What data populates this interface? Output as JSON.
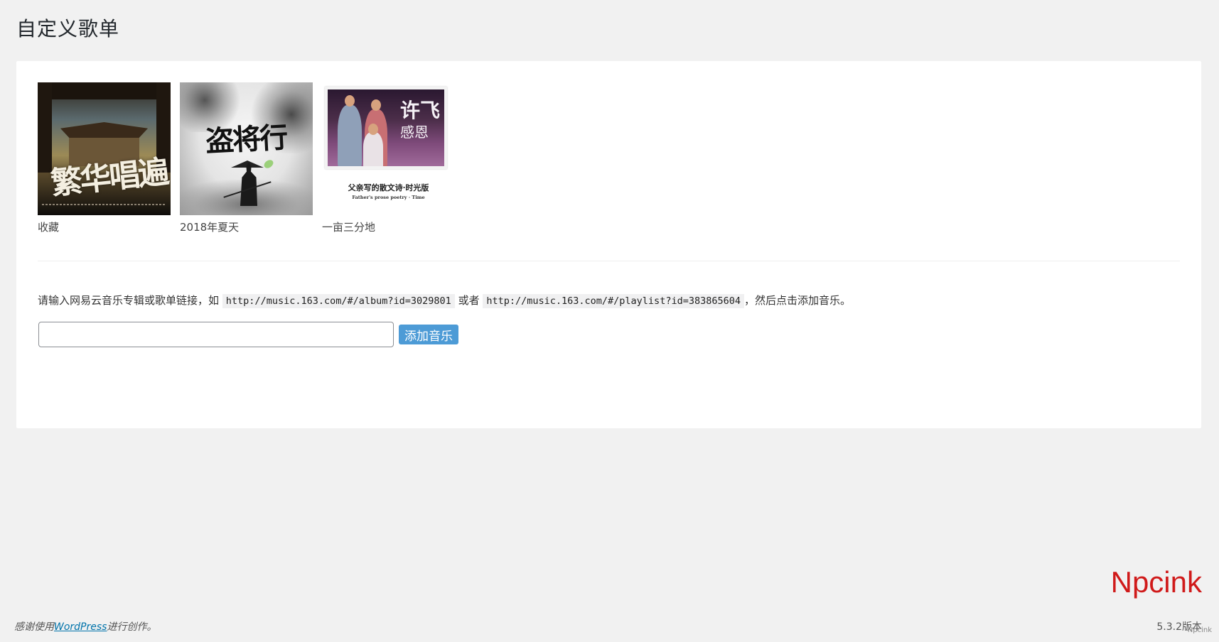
{
  "page": {
    "title": "自定义歌单"
  },
  "albums": [
    {
      "name": "收藏",
      "cover_text": "繁华唱遍"
    },
    {
      "name": "2018年夏天",
      "cover_text": "盗将行"
    },
    {
      "name": "一亩三分地",
      "cover_text": "许飞",
      "cover_subtext": "感恩",
      "cover_caption": "父亲写的散文诗·时光版",
      "cover_caption_en": "Father's prose poetry · Time"
    }
  ],
  "instructions": {
    "prefix": "请输入网易云音乐专辑或歌单链接，如",
    "example_album": "http://music.163.com/#/album?id=3029801",
    "middle": "或者",
    "example_playlist": "http://music.163.com/#/playlist?id=383865604",
    "suffix": "，然后点击添加音乐。"
  },
  "form": {
    "input_value": "",
    "add_label": "添加音乐"
  },
  "watermark": "Npcink",
  "footer": {
    "thanks_prefix": "感谢使用",
    "wordpress_link": "WordPress",
    "thanks_suffix": "进行创作。",
    "version": "5.3.2版本",
    "mark": "Npcink"
  },
  "colors": {
    "button": "#4d9bd6",
    "link": "#0073aa",
    "watermark": "#d01a1a",
    "background": "#f1f1f1"
  }
}
